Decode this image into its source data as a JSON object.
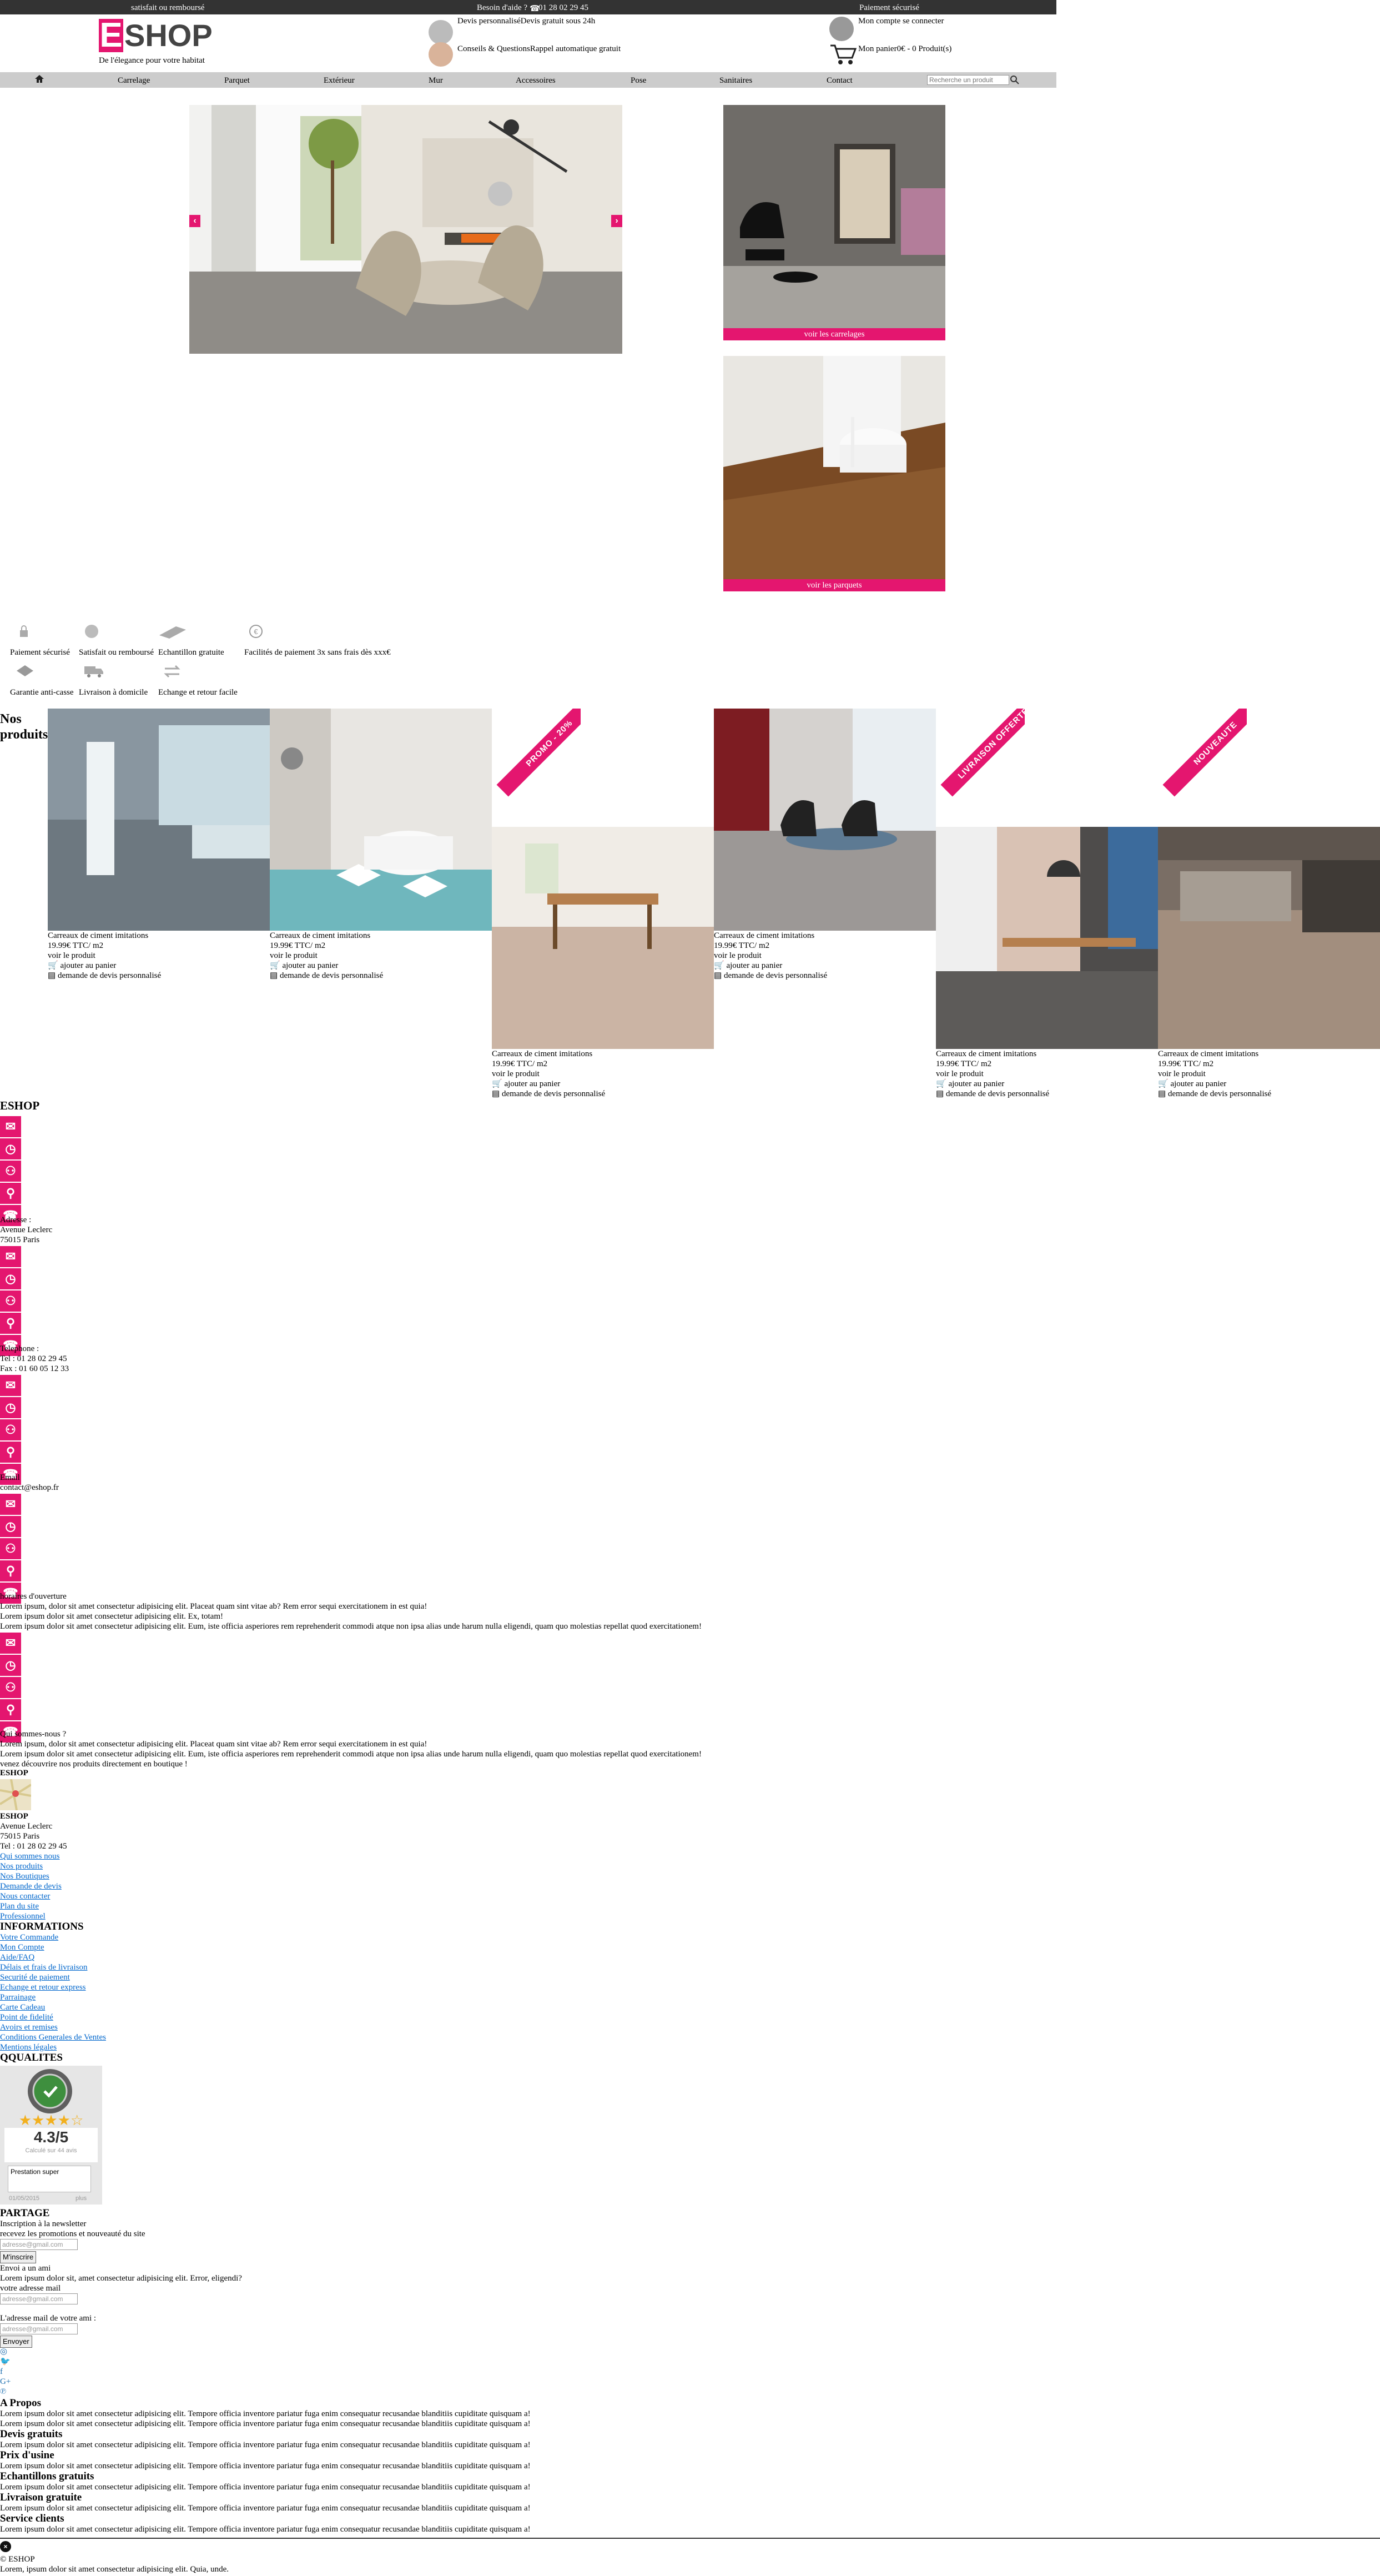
{
  "topbar": {
    "left": "satisfait ou remboursé",
    "help": "Besoin d'aide ?",
    "phone": "01 28 02 29 45",
    "right": "Paiement sécurisé"
  },
  "brand": {
    "letter": "E",
    "name": "SHOP",
    "tagline": "De l'élegance pour votre habitat",
    "pink": "#e4166f"
  },
  "header": {
    "quote": "Devis personnalisé",
    "quote_fast": "Devis gratuit sous 24h",
    "advice": "Conseils & Questions",
    "callback": "Rappel automatique gratuit",
    "account": "Mon compte",
    "login": "se connecter",
    "cart": "Mon panier",
    "cart_count": "0€ - 0 Produit(s)"
  },
  "nav": {
    "home_icon": "home-icon",
    "items": [
      "Carrelage",
      "Parquet",
      "Extérieur",
      "Mur",
      "Accessoires",
      "Pose",
      "Sanitaires",
      "Contact"
    ],
    "search_placeholder": "Recherche un produit"
  },
  "categories": {
    "tiles_label": "voir les carrelages",
    "parquet_label": "voir les parquets"
  },
  "reassurance": [
    "Paiement sécurisé",
    "Satisfait ou remboursé",
    "Echantillon gratuite",
    "Facilités de paiement 3x sans frais dès xxx€",
    "Garantie anti-casse",
    "Livraison à domicile",
    "Echange et retour facile"
  ],
  "products": {
    "heading_1": "Nos",
    "heading_2": "produits",
    "items": [
      {
        "name": "Carreaux de ciment imitations",
        "price": "19.99€ TTC/ m2",
        "link": "voir le produit",
        "cart": "ajouter au panier",
        "quote": "demande de devis personnalisé",
        "badge": ""
      },
      {
        "name": "Carreaux de ciment imitations",
        "price": "19.99€ TTC/ m2",
        "link": "voir le produit",
        "cart": "ajouter au panier",
        "quote": "demande de devis personnalisé",
        "badge": ""
      },
      {
        "name": "Carreaux de ciment imitations",
        "price": "19.99€ TTC/ m2",
        "link": "voir le produit",
        "cart": "ajouter au panier",
        "quote": "demande de devis personnalisé",
        "badge": "PROMO - 20%"
      },
      {
        "name": "Carreaux de ciment imitations",
        "price": "19.99€ TTC/ m2",
        "link": "voir le produit",
        "cart": "ajouter au panier",
        "quote": "demande de devis personnalisé",
        "badge": ""
      },
      {
        "name": "Carreaux de ciment imitations",
        "price": "19.99€ TTC/ m2",
        "link": "voir le produit",
        "cart": "ajouter au panier",
        "quote": "demande de devis personnalisé",
        "badge": "LIVRAISON OFFERTE"
      },
      {
        "name": "Carreaux de ciment imitations",
        "price": "19.99€ TTC/ m2",
        "link": "voir le produit",
        "cart": "ajouter au panier",
        "quote": "demande de devis personnalisé",
        "badge": "NOUVEAUTE"
      }
    ]
  },
  "contact": {
    "title": "ESHOP",
    "address_label": "Adresse :",
    "address_1": "Avenue Leclerc",
    "address_2": "75015 Paris",
    "phone_label": "Telephone :",
    "tel": "Tel : 01 28 02 29 45",
    "fax": "Fax : 01 60 05 12 33",
    "email_label": "Email",
    "email": "contact@eshop.fr",
    "hours_label": "horaires d'ouverture",
    "lorem_1": "Lorem ipsum, dolor sit amet consectetur adipisicing elit. Placeat quam sint vitae ab? Rem error sequi exercitationem in est quia!",
    "lorem_2": "Lorem ipsum dolor sit amet consectetur adipisicing elit. Ex, totam!",
    "lorem_3": "Lorem ipsum dolor sit amet consectetur adipisicing elit. Eum, iste officia asperiores rem reprehenderit commodi atque non ipsa alias unde harum nulla eligendi, quam quo molestias repellat quod exercitationem!",
    "about_label": "Qui sommes-nous ?",
    "about_1": "Lorem ipsum, dolor sit amet consectetur adipisicing elit. Placeat quam sint vitae ab? Rem error sequi exercitationem in est quia!",
    "about_2": "Lorem ipsum dolor sit amet consectetur adipisicing elit. Eum, iste officia asperiores rem reprehenderit commodi atque non ipsa alias unde harum nulla eligendi, quam quo molestias repellat quod exercitationem!",
    "about_3": "venez découvrire nos produits directement en boutique !"
  },
  "footer": {
    "store_title": "ESHOP",
    "store_name": "ESHOP",
    "store_addr_1": "Avenue Leclerc",
    "store_addr_2": "75015 Paris",
    "store_tel": "Tel : 01 28 02 29 45",
    "links": [
      "Qui sommes nous",
      "Nos produits",
      "Nos Boutiques",
      "Demande de devis",
      "Nous contacter",
      "Plan du site",
      "Professionnel"
    ],
    "info_title": "INFORMATIONS",
    "info_links": [
      "Votre Commande",
      "Mon Compte",
      "Aide/FAQ",
      "Délais et frais de livraison",
      "Securité de paiement",
      "Echange et retour express",
      "Parrainage",
      "Carte Cadeau",
      "Point de fidelité",
      "Avoirs et remises",
      "Conditions Generales de Ventes",
      "Mentions légales"
    ],
    "qualities_title": "QQUALITES",
    "rating": "4.3/5",
    "rating_sub": "Calculé sur 44 avis",
    "review_text": "Prestation super",
    "review_date": "01/05/2015",
    "review_more": "plus",
    "share_title": "PARTAGE",
    "newsletter": "Inscription à la newsletter",
    "newsletter_sub": "recevez les promotions et nouveauté du site",
    "email_placeholder": "adresse@gmail.com",
    "subscribe": "M'inscrire",
    "friend_title": "Envoi a un ami",
    "friend_lorem": "Lorem ipsum dolor sit, amet consectetur adipisicing elit. Error, eligendi?",
    "your_email": "votre adresse mail",
    "friend_email": "L'adresse mail de votre ami :",
    "send": "Envoyer",
    "social": [
      "rss-icon",
      "twitter-icon",
      "facebook-icon",
      "googleplus-icon",
      "pinterest-icon"
    ],
    "social_glyphs": [
      "◎",
      "🐦",
      "f",
      "G+",
      "℗"
    ],
    "about_title": "A Propos",
    "about_lorem": "Lorem ipsum dolor sit amet consectetur adipisicing elit. Tempore officia inventore pariatur fuga enim consequatur recusandae blanditiis cupiditate quisquam a!",
    "sections": [
      "Devis gratuits",
      "Prix d'usine",
      "Echantillons gratuits",
      "Livraison gratuite",
      "Service clients"
    ],
    "copyright": "© ESHOP",
    "copy_lorem": "Lorem, ipsum dolor sit amet consectetur adipisicing elit. Quia, unde."
  }
}
